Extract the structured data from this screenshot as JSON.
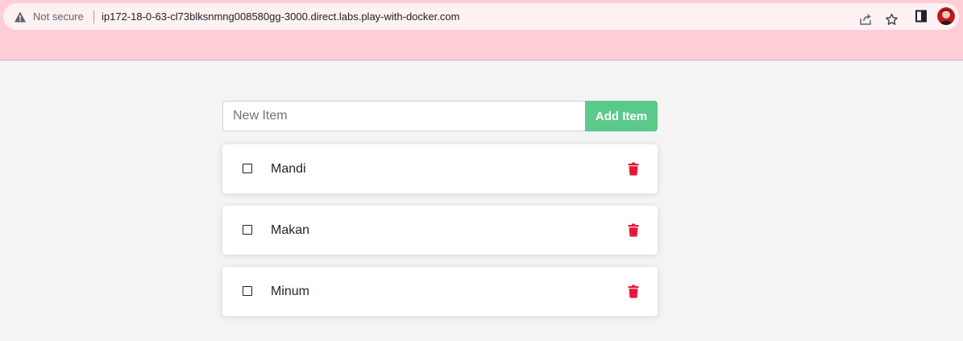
{
  "browser": {
    "security_label": "Not secure",
    "url": "ip172-18-0-63-cl73blksnmng008580gg-3000.direct.labs.play-with-docker.com",
    "toolbar_color": "#ffcdd6"
  },
  "app": {
    "new_item": {
      "placeholder": "New Item",
      "value": ""
    },
    "add_button_label": "Add Item",
    "accent_color": "#5bc98a",
    "delete_color": "#e8173a",
    "items": [
      {
        "name": "Mandi",
        "completed": false
      },
      {
        "name": "Makan",
        "completed": false
      },
      {
        "name": "Minum",
        "completed": false
      }
    ]
  },
  "icons": {
    "security": "warning-triangle-icon",
    "share": "share-icon",
    "bookmark": "star-icon",
    "side_panel": "side-panel-icon",
    "profile": "avatar",
    "item_checkbox": "checkbox-icon",
    "item_delete": "trash-icon"
  }
}
